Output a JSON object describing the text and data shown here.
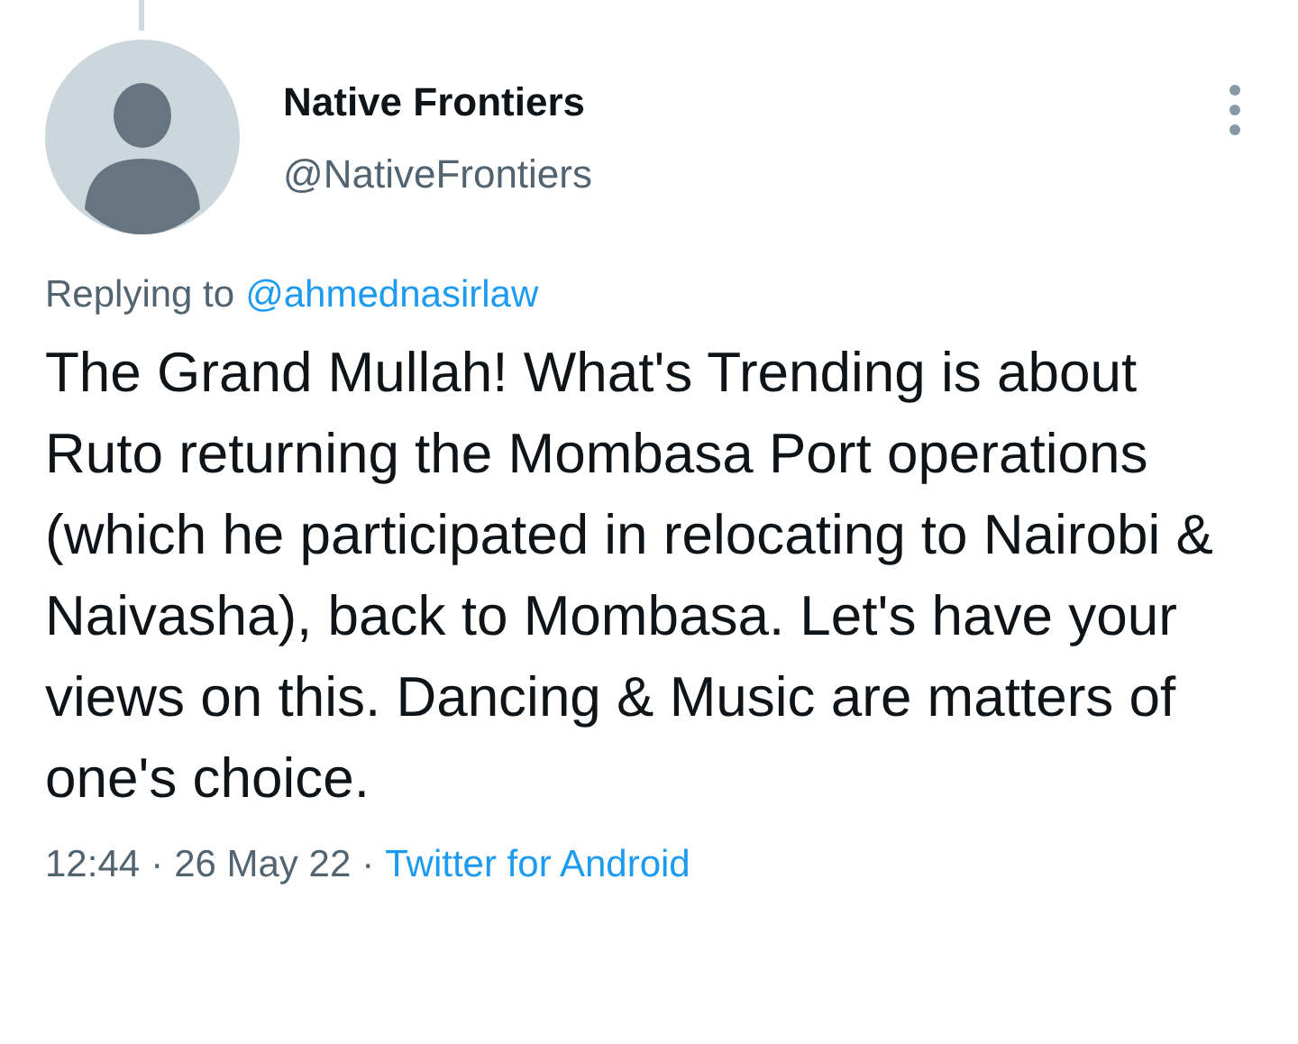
{
  "author": {
    "name": "Native Frontiers",
    "handle": "@NativeFrontiers"
  },
  "reply": {
    "prefix": "Replying to",
    "mention": "@ahmednasirlaw"
  },
  "body": "The Grand Mullah! What's Trending is about Ruto returning the Mombasa Port operations (which he participated in relocating to Nairobi & Naivasha), back to Mombasa. Let's have your views on this. Dancing & Music are matters of one's choice.",
  "meta": {
    "time": "12:44",
    "separator": "·",
    "date": "26 May 22",
    "source": "Twitter for Android"
  }
}
